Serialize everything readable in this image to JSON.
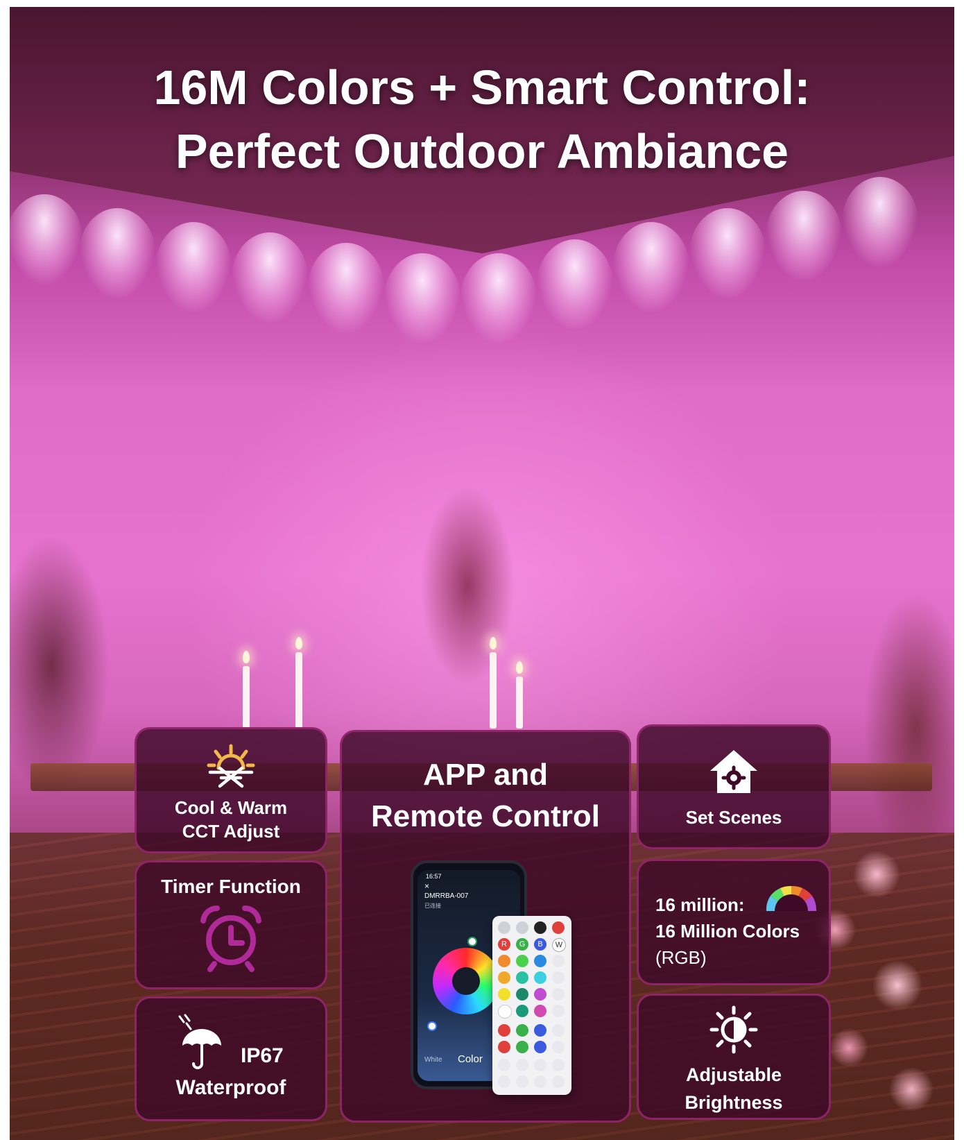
{
  "headline": {
    "line1": "16M Colors + Smart Control:",
    "line2": "Perfect Outdoor Ambiance"
  },
  "features": {
    "cct": {
      "line1": "Cool & Warm",
      "line2": "CCT Adjust",
      "icon": "sun-snowflake-icon"
    },
    "timer": {
      "label": "Timer Function",
      "icon": "alarm-clock-icon"
    },
    "waterproof": {
      "rating": "IP67",
      "label": "Waterproof",
      "icon": "umbrella-rain-icon"
    },
    "app": {
      "line1": "APP and",
      "line2": "Remote Control"
    },
    "scenes": {
      "label": "Set Scenes",
      "icon": "home-gear-icon"
    },
    "colors": {
      "line1": "16 million:",
      "line2": "16 Million Colors",
      "line3": "(RGB)",
      "icon": "color-fan-icon"
    },
    "brightness": {
      "line1": "Adjustable",
      "line2": "Brightness",
      "icon": "brightness-icon"
    }
  },
  "phone": {
    "time": "16:57",
    "device_name": "DMRRBA-007",
    "status": "已连接",
    "tab_white": "White",
    "tab_color": "Color"
  },
  "remote": {
    "row1": [
      "R",
      "G",
      "B",
      "W"
    ]
  },
  "colors": {
    "card_bg": "#3e0a28",
    "card_border": "#962a6e",
    "accent_purple": "#b02a9a",
    "icon_gold": "#f2b84a"
  }
}
